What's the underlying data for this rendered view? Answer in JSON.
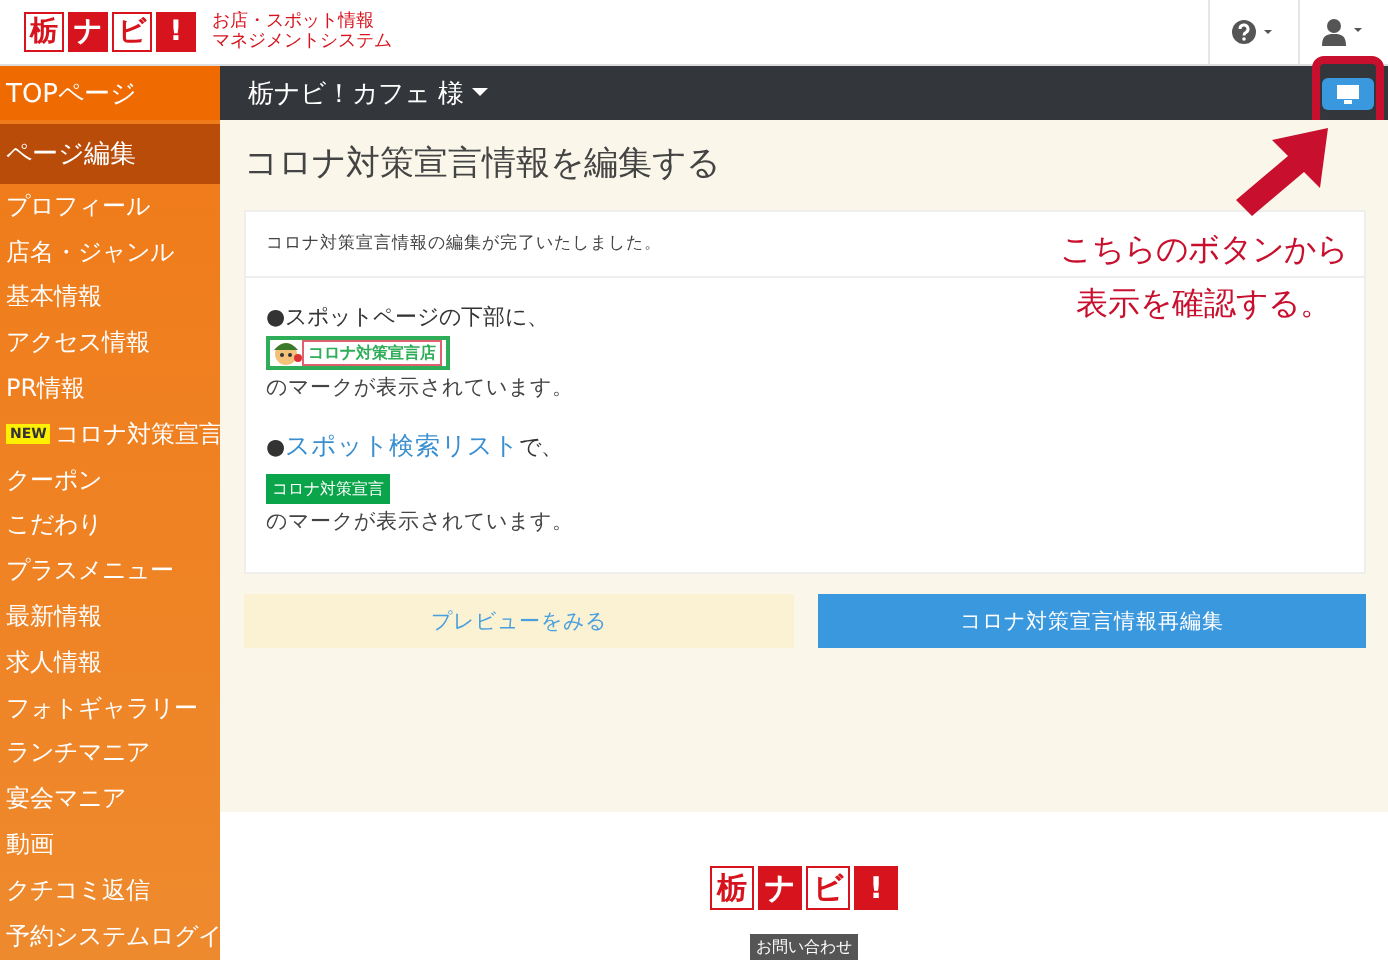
{
  "header": {
    "logo": [
      "栃",
      "ナ",
      "ビ",
      "!"
    ],
    "tagline": [
      "お店・スポット情報",
      "マネジメントシステム"
    ]
  },
  "sidebar": {
    "items": [
      {
        "label": "TOPページ",
        "kind": "top"
      },
      {
        "label": "ページ編集",
        "kind": "section"
      },
      {
        "label": "プロフィール",
        "kind": "link"
      },
      {
        "label": "店名・ジャンル",
        "kind": "link"
      },
      {
        "label": "基本情報",
        "kind": "link"
      },
      {
        "label": "アクセス情報",
        "kind": "link"
      },
      {
        "label": "PR情報",
        "kind": "link"
      },
      {
        "label": "コロナ対策宣言",
        "kind": "link",
        "badge": "NEW"
      },
      {
        "label": "クーポン",
        "kind": "link"
      },
      {
        "label": "こだわり",
        "kind": "link"
      },
      {
        "label": "プラスメニュー",
        "kind": "link"
      },
      {
        "label": "最新情報",
        "kind": "link"
      },
      {
        "label": "求人情報",
        "kind": "link"
      },
      {
        "label": "フォトギャラリー",
        "kind": "link"
      },
      {
        "label": "ランチマニア",
        "kind": "link"
      },
      {
        "label": "宴会マニア",
        "kind": "link"
      },
      {
        "label": "動画",
        "kind": "link"
      },
      {
        "label": "クチコミ返信",
        "kind": "link"
      },
      {
        "label": "予約システムログイ",
        "kind": "link"
      }
    ]
  },
  "topbar": {
    "shop": "栃ナビ！カフェ 様"
  },
  "page": {
    "title": "コロナ対策宣言情報を編集する",
    "notice": "コロナ対策宣言情報の編集が完了いたしました。",
    "blocks": [
      {
        "bullet": "●",
        "before": "スポットページの下部に、",
        "kind": "badge",
        "mark": "コロナ対策宣言店",
        "note": "のマークが表示されています。"
      },
      {
        "bullet": "●",
        "link": "スポット検索リスト",
        "after": "で、",
        "kind": "tag",
        "mark": "コロナ対策宣言",
        "note": "のマークが表示されています。"
      }
    ],
    "buttons": [
      {
        "label": "プレビューをみる",
        "kind": "secondary"
      },
      {
        "label": "コロナ対策宣言情報再編集",
        "kind": "primary"
      }
    ]
  },
  "annotation": {
    "lines": [
      "こちらのボタンから",
      "表示を確認する。"
    ]
  },
  "footer": {
    "logo": [
      "栃",
      "ナ",
      "ビ",
      "!"
    ],
    "contact": "お問い合わせ"
  }
}
